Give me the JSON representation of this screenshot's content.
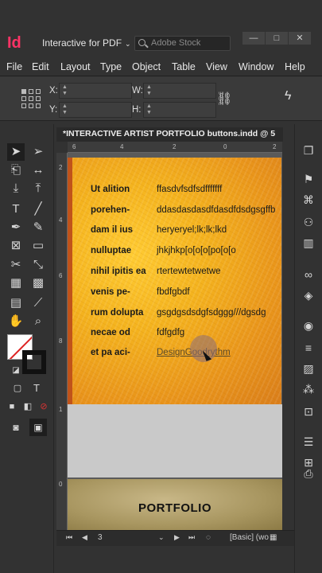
{
  "app": {
    "logo": "Id",
    "workspace": "Interactive for PDF",
    "search_placeholder": "Adobe Stock"
  },
  "window_controls": {
    "minimize": "—",
    "maximize": "□",
    "close": "✕"
  },
  "menu": [
    "File",
    "Edit",
    "Layout",
    "Type",
    "Object",
    "Table",
    "View",
    "Window",
    "Help"
  ],
  "control": {
    "x_label": "X:",
    "y_label": "Y:",
    "w_label": "W:",
    "h_label": "H:"
  },
  "document": {
    "tab_title": "*INTERACTIVE ARTIST PORTFOLIO buttons.indd @ 5"
  },
  "ruler": {
    "h": [
      "6",
      "4",
      "2",
      "0",
      "2"
    ],
    "v": [
      "2",
      "4",
      "6",
      "8",
      "1",
      "0"
    ]
  },
  "form_rows": [
    {
      "label": "Ut alition",
      "value": "ffasdvfsdfsdfffffff"
    },
    {
      "label": "porehen-",
      "value": "ddasdasdasdfdasdfdsdgsgffb"
    },
    {
      "label": "dam il ius",
      "value": "heryeryel;lk;lk;lkd"
    },
    {
      "label": "nulluptae",
      "value": "jhkjhkp[o[o[o[po[o[o"
    },
    {
      "label": "nihil ipitis ea",
      "value": "rtertewtetwetwe"
    },
    {
      "label": "venis pe-",
      "value": "fbdfgbdf"
    },
    {
      "label": "rum dolupta",
      "value": "gsgdgsdsdgfsdggg///dgsdg"
    },
    {
      "label": "necae od",
      "value": "fdfgdfg"
    },
    {
      "label": "et pa aci-",
      "value": "DesignGoodrythm"
    }
  ],
  "portfolio_label": "PORTFOLIO",
  "status": {
    "page": "3",
    "style": "[Basic] (wo"
  },
  "colors": {
    "logo": "#ff3366",
    "page_yellow": "#f4b31e",
    "gray_band": "#c9c9c9"
  }
}
